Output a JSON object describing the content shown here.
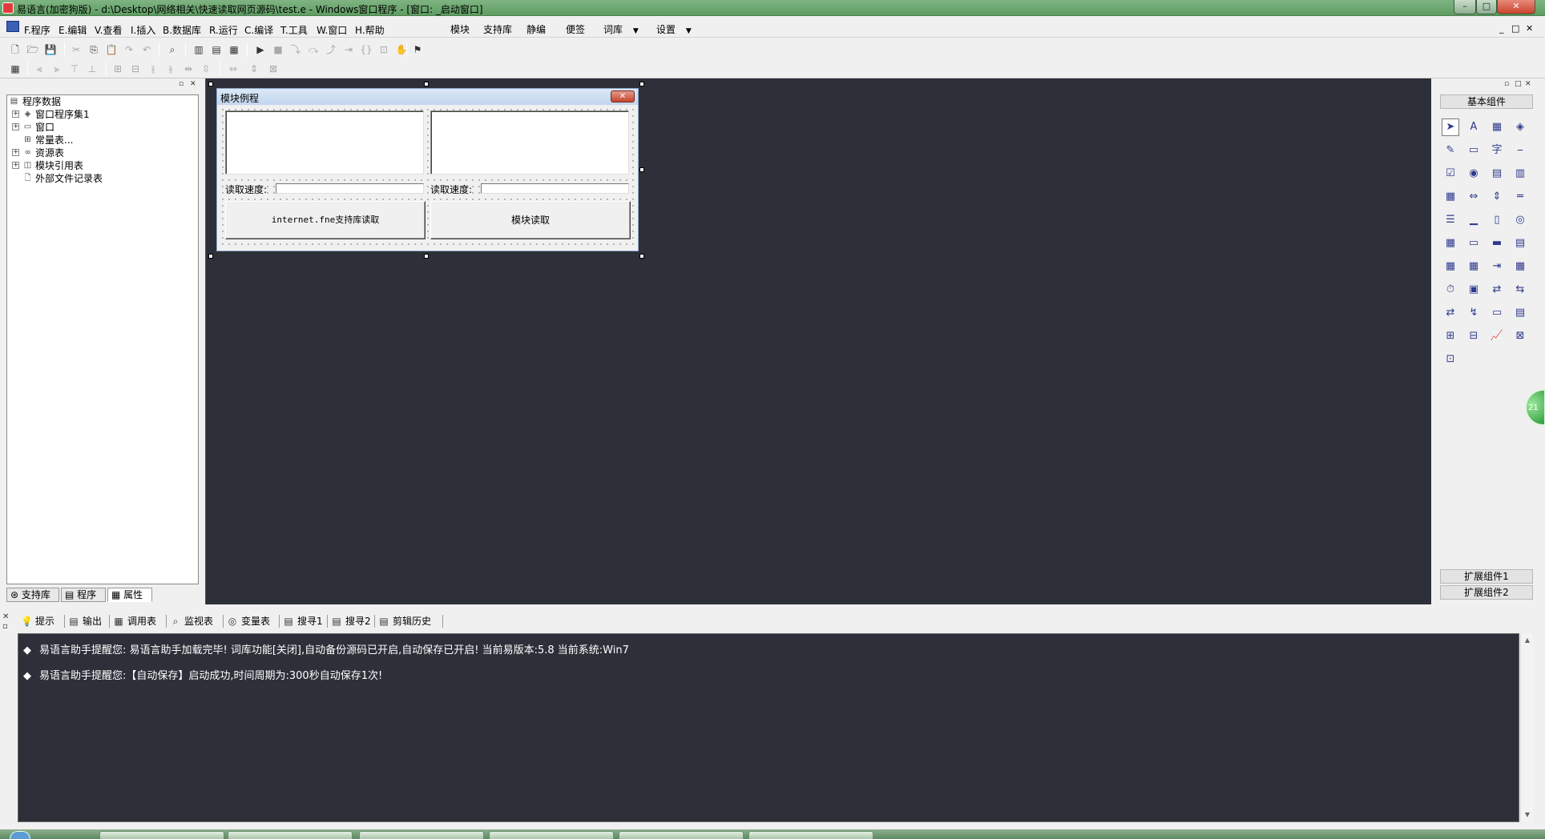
{
  "window": {
    "title": "易语言(加密狗版) - d:\\Desktop\\网络相关\\快速读取网页源码\\test.e - Windows窗口程序 - [窗口: _启动窗口]",
    "min": "–",
    "max": "□",
    "close": "✕"
  },
  "menu": {
    "items": [
      "F.程序",
      "E.编辑",
      "V.查看",
      "I.插入",
      "B.数据库",
      "R.运行",
      "C.编译",
      "T.工具",
      "W.窗口",
      "H.帮助"
    ],
    "extras": [
      "模块",
      "支持库",
      "静编",
      "便签",
      "词库",
      "设置"
    ],
    "mdi": [
      "_",
      "□",
      "✕"
    ]
  },
  "tree": {
    "root": "程序数据",
    "items": [
      "窗口程序集1",
      "窗口",
      "常量表...",
      "资源表",
      "模块引用表",
      "外部文件记录表"
    ],
    "expander": "+"
  },
  "left_tabs": [
    "支持库",
    "程序",
    "属性"
  ],
  "form": {
    "title": "模块例程",
    "close": "✕",
    "label1": "读取速度:",
    "label2": "读取速度:",
    "button1": "internet.fne支持库读取",
    "button2": "模块读取"
  },
  "components": {
    "header": "基本组件",
    "footer1": "扩展组件1",
    "footer2": "扩展组件2",
    "icons": [
      "➤",
      "A",
      "▦",
      "◈",
      "✎",
      "▭",
      "字",
      "⎯",
      "☑",
      "◉",
      "▤",
      "▥",
      "▦",
      "⇔",
      "⇕",
      "═",
      "☰",
      "▁",
      "▯",
      "◎",
      "▦",
      "▭",
      "▬",
      "▤",
      "▦",
      "▦",
      "⇥",
      "▦",
      "⏱",
      "▣",
      "⇄",
      "⇆",
      "⇄",
      "↯",
      "▭",
      "▤",
      "⊞",
      "⊟",
      "📈",
      "⊠",
      "⊡"
    ],
    "bubble": "21"
  },
  "bottom_tabs": [
    "提示",
    "输出",
    "调用表",
    "监视表",
    "变量表",
    "搜寻1",
    "搜寻2",
    "剪辑历史"
  ],
  "bottom_tab_icons": [
    "💡",
    "▤",
    "▦",
    "⌕",
    "◎",
    "▤",
    "▤",
    "▤"
  ],
  "output": {
    "lines": [
      "易语言助手提醒您:  易语言助手加载完毕!  词库功能[关闭],自动备份源码已开启,自动保存已开启!  当前易版本:5.8  当前系统:Win7",
      "易语言助手提醒您:【自动保存】启动成功,时间周期为:300秒自动保存1次!"
    ],
    "bullet": "◆"
  },
  "panel_ctl": [
    "▫",
    "□",
    "✕"
  ]
}
